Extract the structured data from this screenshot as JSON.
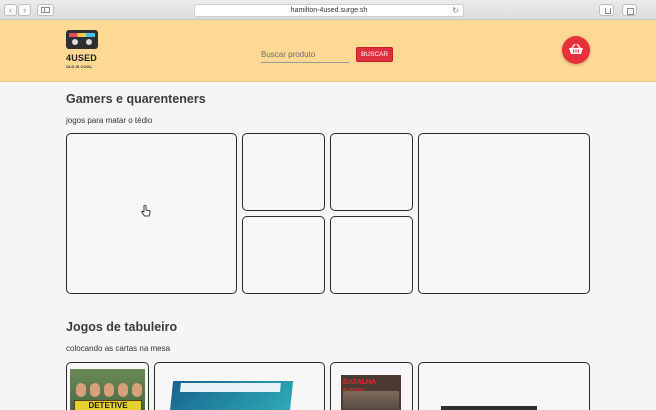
{
  "browser": {
    "url": "hamilton-4used.surge.sh",
    "back_glyph": "‹",
    "forward_glyph": "›",
    "reload_glyph": "↻",
    "new_tab_glyph": "+"
  },
  "header": {
    "brand_name": "4USED",
    "brand_tagline": "OLD IS COOL.",
    "search_placeholder": "Buscar produto",
    "search_button": "BUSCAR",
    "cart_icon": "basket-icon",
    "accent_color": "#e8303b",
    "background_color": "#fdd994"
  },
  "sections": [
    {
      "title": "Gamers e quarenteners",
      "subtitle": "jogos para matar o tédio"
    },
    {
      "title": "Jogos de tabuleiro",
      "subtitle": "colocando as cartas na mesa",
      "products": [
        {
          "art_text": "DETETIVE"
        },
        {
          "art_text": ""
        },
        {
          "art_text": "BATALHA NAVAL"
        },
        {
          "art_text": ""
        }
      ]
    }
  ]
}
